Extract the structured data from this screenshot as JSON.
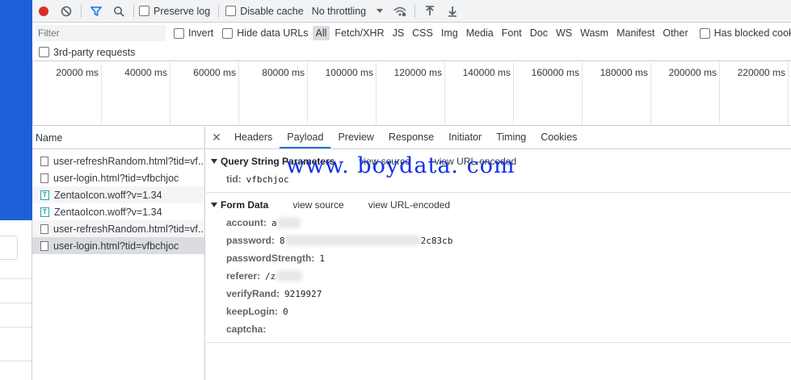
{
  "toolbar": {
    "preserve_log": "Preserve log",
    "disable_cache": "Disable cache",
    "throttling": "No throttling"
  },
  "filterbar": {
    "placeholder": "Filter",
    "invert": "Invert",
    "hide_data_urls": "Hide data URLs",
    "types": [
      "All",
      "Fetch/XHR",
      "JS",
      "CSS",
      "Img",
      "Media",
      "Font",
      "Doc",
      "WS",
      "Wasm",
      "Manifest",
      "Other"
    ],
    "has_blocked": "Has blocked cookies"
  },
  "third_party": "3rd-party requests",
  "timeline": {
    "ticks": [
      "20000 ms",
      "40000 ms",
      "60000 ms",
      "80000 ms",
      "100000 ms",
      "120000 ms",
      "140000 ms",
      "160000 ms",
      "180000 ms",
      "200000 ms",
      "220000 ms"
    ]
  },
  "list": {
    "header": "Name",
    "rows": [
      {
        "name": "user-refreshRandom.html?tid=vf...",
        "type": "doc"
      },
      {
        "name": "user-login.html?tid=vfbchjoc",
        "type": "doc"
      },
      {
        "name": "ZentaoIcon.woff?v=1.34",
        "type": "font"
      },
      {
        "name": "ZentaoIcon.woff?v=1.34",
        "type": "font"
      },
      {
        "name": "user-refreshRandom.html?tid=vf...",
        "type": "doc"
      },
      {
        "name": "user-login.html?tid=vfbchjoc",
        "type": "doc"
      }
    ]
  },
  "tabs": [
    "Headers",
    "Payload",
    "Preview",
    "Response",
    "Initiator",
    "Timing",
    "Cookies"
  ],
  "query": {
    "title": "Query String Parameters",
    "view_source": "view source",
    "view_url_encoded": "view URL-encoded",
    "tid_key": "tid:",
    "tid_val": "vfbchjoc"
  },
  "form": {
    "title": "Form Data",
    "view_source": "view source",
    "view_url_encoded": "view URL-encoded",
    "account_key": "account:",
    "account_val": "a",
    "password_key": "password:",
    "password_val_start": "8",
    "password_val_end": "2c83cb",
    "strength_key": "passwordStrength:",
    "strength_val": "1",
    "referer_key": "referer:",
    "referer_val": "/z",
    "verify_key": "verifyRand:",
    "verify_val": "9219927",
    "keep_key": "keepLogin:",
    "keep_val": "0",
    "captcha_key": "captcha:",
    "captcha_val": ""
  },
  "watermark": "www. boydata. com"
}
